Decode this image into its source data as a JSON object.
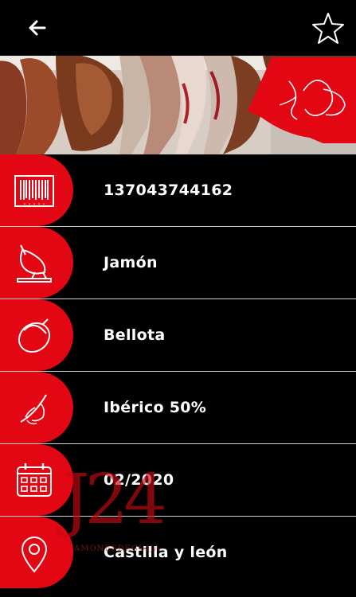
{
  "header": {
    "back_icon": "arrow-left-icon",
    "favorite_icon": "star-outline-icon"
  },
  "banner": {
    "image": "hanging-hams-photo",
    "badge_logo": "brand-logo-icon"
  },
  "details": [
    {
      "icon": "barcode-icon",
      "value": "137043744162"
    },
    {
      "icon": "ham-stand-icon",
      "value": "Jamón"
    },
    {
      "icon": "acorn-icon",
      "value": "Bellota"
    },
    {
      "icon": "feather-icon",
      "value": "Ibérico 50%"
    },
    {
      "icon": "calendar-icon",
      "value": "02/2020"
    },
    {
      "icon": "location-pin-icon",
      "value": "Castilla y león"
    }
  ],
  "watermark": {
    "text": "J24",
    "subtext": "JAMONESDEGUIJA"
  },
  "colors": {
    "accent": "#e30613",
    "background": "#000000",
    "text": "#ffffff",
    "divider": "#cfcfcf"
  }
}
